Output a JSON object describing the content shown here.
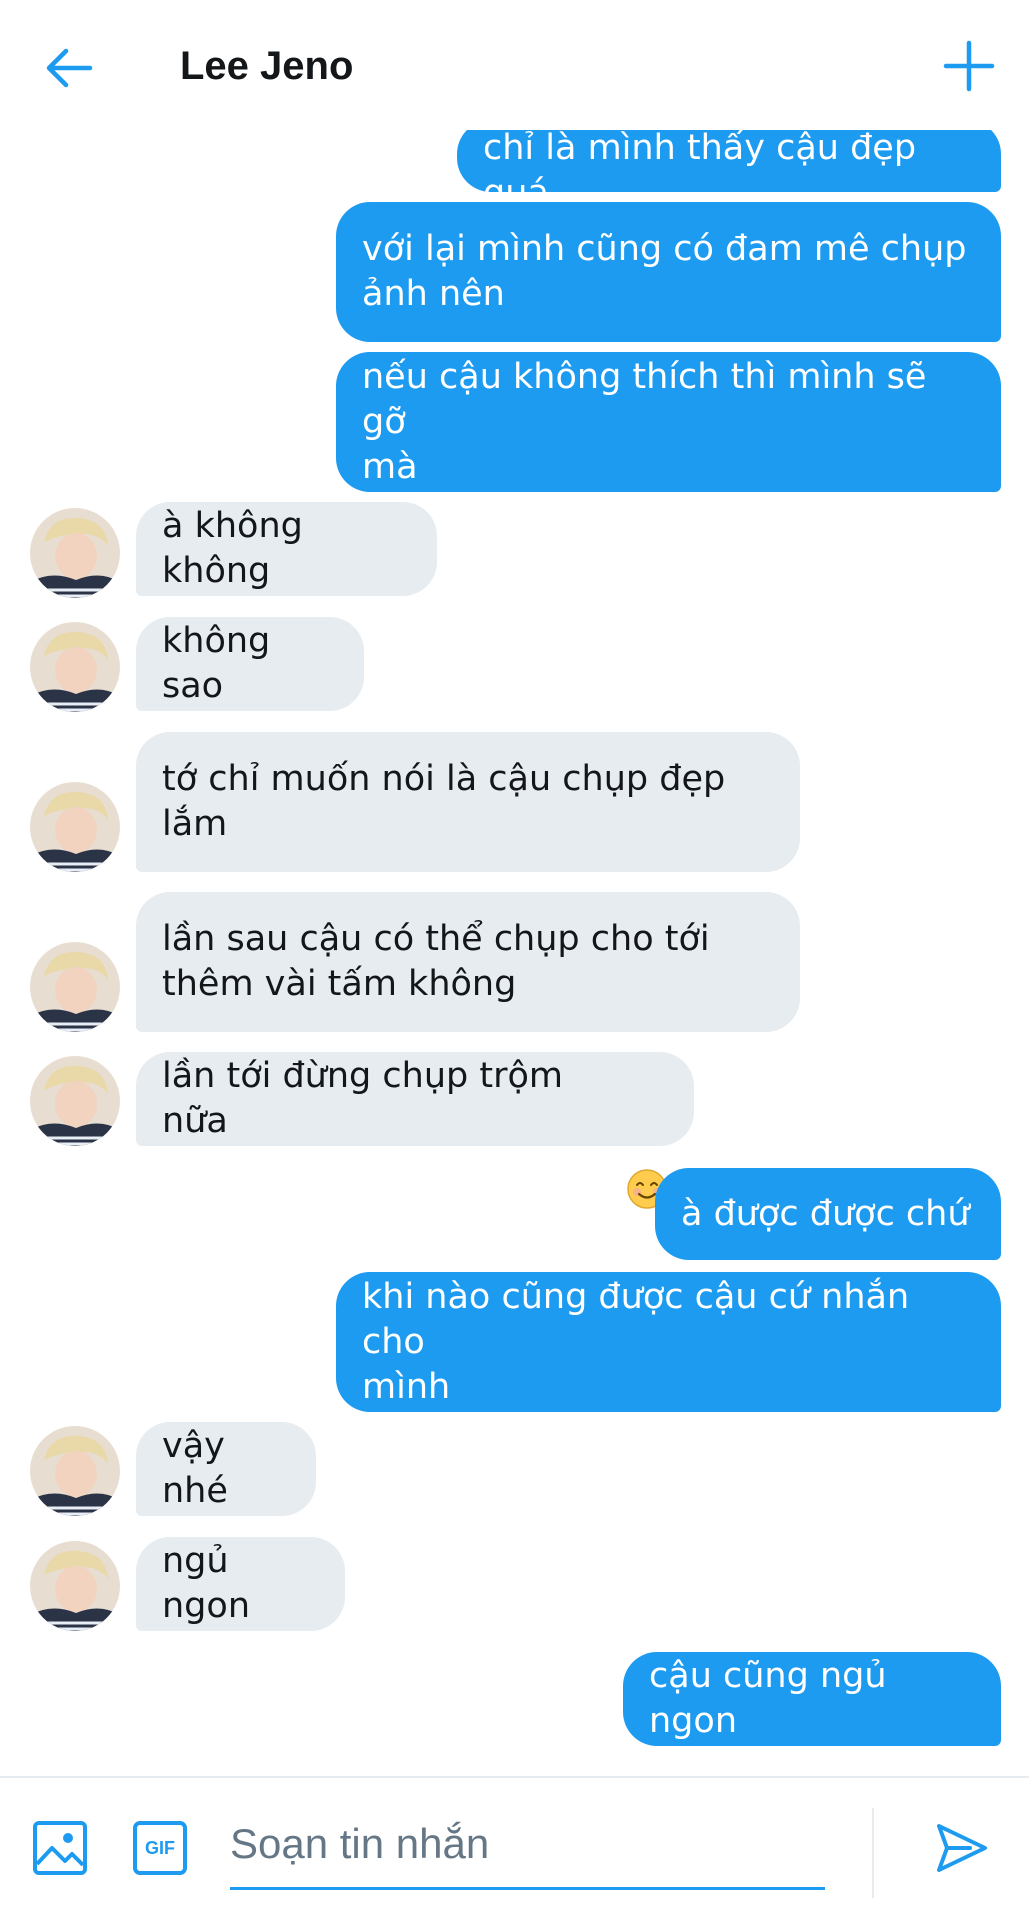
{
  "header": {
    "title": "Lee Jeno",
    "back_icon": "back-arrow-icon",
    "add_icon": "plus-icon"
  },
  "colors": {
    "accent": "#1d9bf0",
    "incoming_bubble": "#e7ecf0",
    "text": "#14171a",
    "placeholder": "#657786"
  },
  "messages": [
    {
      "dir": "out",
      "text": "chỉ là mình thấy cậu đẹp quá"
    },
    {
      "dir": "out",
      "text": "với lại mình cũng có đam mê chụp\nảnh nên"
    },
    {
      "dir": "out",
      "text": "nếu cậu không thích thì mình sẽ gỡ\nmà"
    },
    {
      "dir": "in",
      "text": "à không không"
    },
    {
      "dir": "in",
      "text": "không sao"
    },
    {
      "dir": "in",
      "text": "tớ chỉ muốn nói là cậu chụp đẹp\nlắm"
    },
    {
      "dir": "in",
      "text": "lần sau cậu có thể chụp cho tới\nthêm vài tấm không"
    },
    {
      "dir": "in",
      "text": "lần tới đừng chụp trộm nữa",
      "emoji": "smiling-face-emoji"
    },
    {
      "dir": "out",
      "text": "à được được chứ"
    },
    {
      "dir": "out",
      "text": "khi nào cũng được cậu cứ nhắn cho\nmình"
    },
    {
      "dir": "in",
      "text": "vậy nhé"
    },
    {
      "dir": "in",
      "text": "ngủ ngon"
    },
    {
      "dir": "out",
      "text": "cậu cũng ngủ ngon"
    }
  ],
  "composer": {
    "placeholder": "Soạn tin nhắn",
    "value": "",
    "image_icon": "image-icon",
    "gif_label": "GIF",
    "send_icon": "send-icon"
  }
}
